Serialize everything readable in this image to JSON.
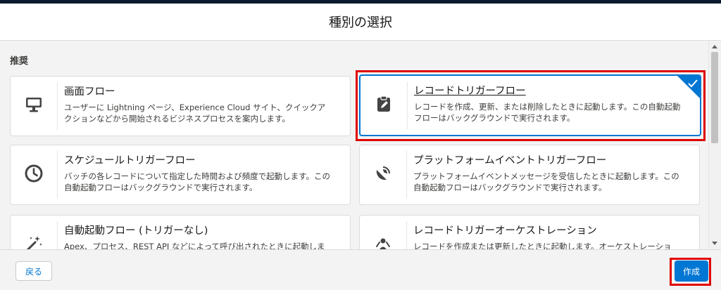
{
  "dialog": {
    "title": "種別の選択",
    "section_label": "推奨"
  },
  "cards": [
    {
      "title": "画面フロー",
      "desc": "ユーザーに Lightning ページ、Experience Cloud サイト、クイックアクションなどから開始されるビジネスプロセスを案内します。",
      "icon": "monitor-icon"
    },
    {
      "title": "レコードトリガーフロー",
      "desc": "レコードを作成、更新、または削除したときに起動します。この自動起動フローはバックグラウンドで実行されます。",
      "icon": "clipboard-edit-icon",
      "selected": true
    },
    {
      "title": "スケジュールトリガーフロー",
      "desc": "バッチの各レコードについて指定した時間および頻度で起動します。この自動起動フローはバックグラウンドで実行されます。",
      "icon": "clock-icon"
    },
    {
      "title": "プラットフォームイベントトリガーフロー",
      "desc": "プラットフォームイベントメッセージを受信したときに起動します。この自動起動フローはバックグラウンドで実行されます。",
      "icon": "signal-dish-icon"
    },
    {
      "title": "自動起動フロー (トリガーなし)",
      "desc": "Apex、プロセス、REST API などによって呼び出されたときに起動しま",
      "icon": "magic-wand-icon"
    },
    {
      "title": "レコードトリガーオーケストレーション",
      "desc": "レコードを作成または更新したときに起動します。オーケストレーショ",
      "icon": "orchestration-icon"
    }
  ],
  "footer": {
    "back_label": "戻る",
    "create_label": "作成"
  },
  "colors": {
    "brand": "#0176d3",
    "highlight": "#e00000",
    "icon": "#444444"
  }
}
